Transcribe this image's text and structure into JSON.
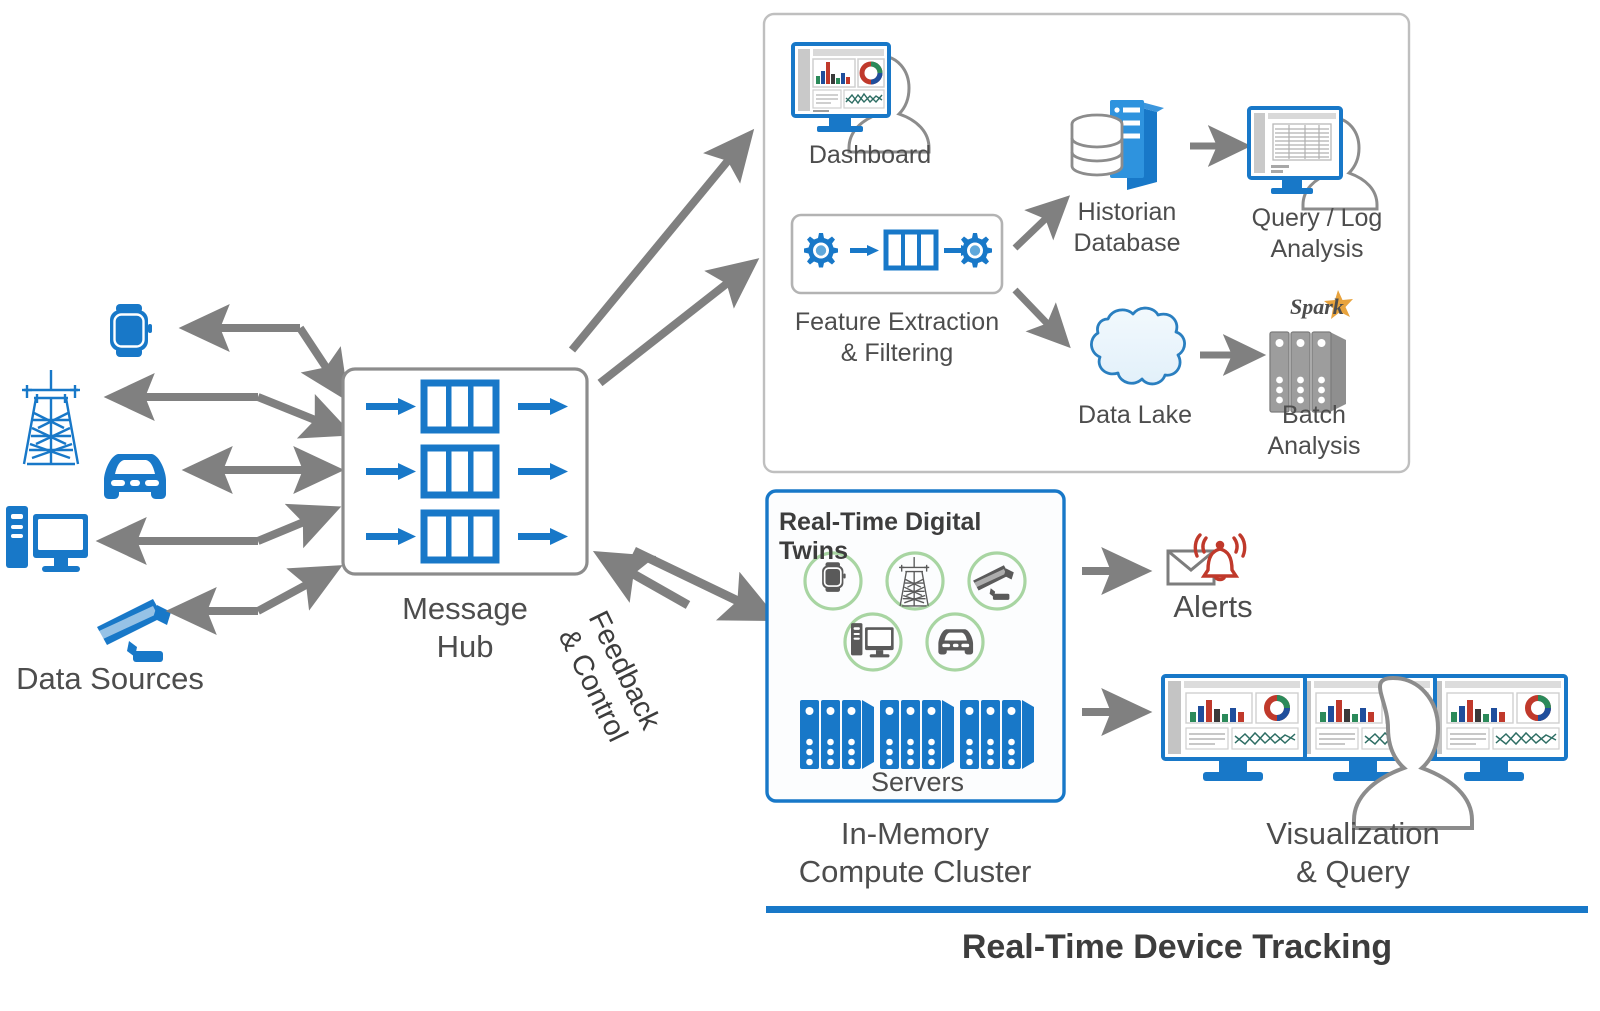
{
  "diagram": {
    "title": "Real-Time Device Tracking",
    "accent_blue": "#1878c8",
    "arrow_gray": "#808080",
    "text_gray": "#4d4d4d",
    "alert_red": "#c0392b",
    "twin_green": "#a8d5a2",
    "spark_orange": "#e8a33d"
  },
  "left": {
    "group_label": "Data Sources",
    "sources": [
      {
        "name": "smartwatch",
        "icon": "watch-icon"
      },
      {
        "name": "power-tower",
        "icon": "transmission-tower-icon"
      },
      {
        "name": "car",
        "icon": "car-icon"
      },
      {
        "name": "workstation",
        "icon": "desktop-computer-icon"
      },
      {
        "name": "security-camera",
        "icon": "cctv-camera-icon"
      }
    ]
  },
  "hub": {
    "label": "Message\nHub",
    "lanes": 3,
    "icon": "message-queue-icon"
  },
  "feedback": {
    "label": "Feedback\n& Control"
  },
  "analytics_panel": {
    "nodes": [
      {
        "id": "dashboard",
        "label": "Dashboard",
        "icon": "dashboard-monitor-icon"
      },
      {
        "id": "feature-extraction",
        "label": "Feature Extraction\n& Filtering",
        "icon": "gear-pipeline-icon"
      },
      {
        "id": "historian-database",
        "label": "Historian\nDatabase",
        "icon": "database-server-icon"
      },
      {
        "id": "query-log-analysis",
        "label": "Query / Log\nAnalysis",
        "icon": "log-monitor-icon"
      },
      {
        "id": "data-lake",
        "label": "Data Lake",
        "icon": "data-lake-cloud-icon"
      },
      {
        "id": "batch-analysis",
        "label": "Batch\nAnalysis",
        "icon": "server-rack-icon",
        "badge": "Spark"
      }
    ]
  },
  "realtime": {
    "box_title": "Real-Time Digital Twins",
    "servers_label": "Servers",
    "cluster_label": "In-Memory\nCompute Cluster",
    "twins": [
      {
        "name": "twin-watch",
        "icon": "watch-icon"
      },
      {
        "name": "twin-tower",
        "icon": "transmission-tower-icon"
      },
      {
        "name": "twin-camera",
        "icon": "cctv-camera-icon"
      },
      {
        "name": "twin-workstation",
        "icon": "desktop-computer-icon"
      },
      {
        "name": "twin-car",
        "icon": "car-icon"
      }
    ]
  },
  "outputs": [
    {
      "id": "alerts",
      "label": "Alerts",
      "icon": "alert-bell-envelope-icon"
    },
    {
      "id": "visualization",
      "label": "Visualization\n& Query",
      "icon": "multi-monitor-icon"
    }
  ]
}
